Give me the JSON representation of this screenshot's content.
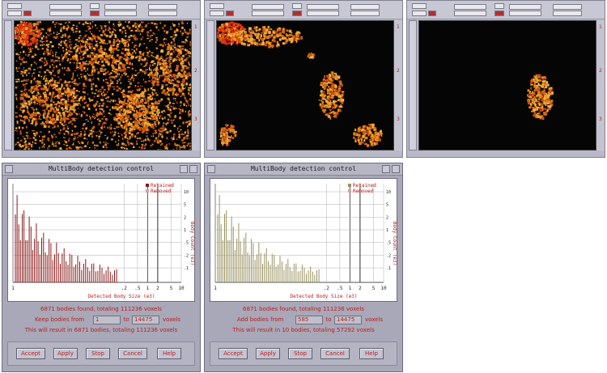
{
  "viewers": [
    {
      "side_labels": [
        "1",
        "2",
        "3"
      ]
    },
    {
      "side_labels": [
        "1",
        "2",
        "3"
      ]
    },
    {
      "side_labels": [
        "1",
        "2",
        "3"
      ]
    }
  ],
  "dialogs": [
    {
      "title": "MultiBody detection control",
      "legend": [
        "Retained",
        "Removed"
      ],
      "xlabel": "Detected Body Size (e3)",
      "ylabel": "Body Count (e3)",
      "x_ticks": [
        "1",
        ".2",
        ".5",
        "1",
        "2",
        "5",
        "10"
      ],
      "y_ticks": [
        "10",
        "5",
        "2",
        "1",
        ".5",
        ".2",
        ".1"
      ],
      "summary": "6871 bodies found, totaling 111236 voxels",
      "range_label": "Keep bodies from",
      "from_value": "1",
      "to_label": "to",
      "to_value": "14475",
      "unit_label": "voxels",
      "result": "This will result in 6871 bodies, totaling 111236 voxels",
      "retained_color": "#8b1a1a",
      "buttons": [
        "Accept",
        "Apply",
        "Stop",
        "Cancel",
        "Help"
      ]
    },
    {
      "title": "MultiBody detection control",
      "legend": [
        "Retained",
        "Removed"
      ],
      "xlabel": "Detected Body Size (e3)",
      "ylabel": "Body Count (e3)",
      "x_ticks": [
        "1",
        ".2",
        ".5",
        "1",
        "2",
        "5",
        "10"
      ],
      "y_ticks": [
        "10",
        "5",
        "2",
        "1",
        ".5",
        ".2",
        ".1"
      ],
      "summary": "6871 bodies found, totaling 111236 voxels",
      "range_label": "Add bodies from",
      "from_value": "585",
      "to_label": "to",
      "to_value": "14475",
      "unit_label": "voxels",
      "result": "This will result in 10 bodies, totaling 57292 voxels",
      "retained_color": "#9a9260",
      "buttons": [
        "Accept",
        "Apply",
        "Stop",
        "Cancel",
        "Help"
      ]
    }
  ],
  "chart_data": [
    {
      "type": "bar",
      "title": "",
      "xlabel": "Detected Body Size (e3)",
      "ylabel": "Body Count (e3)",
      "x_scale": "log",
      "series": [
        {
          "name": "Retained"
        },
        {
          "name": "Removed"
        }
      ],
      "threshold_low": 1,
      "threshold_high": 14475
    },
    {
      "type": "bar",
      "title": "",
      "xlabel": "Detected Body Size (e3)",
      "ylabel": "Body Count (e3)",
      "x_scale": "log",
      "series": [
        {
          "name": "Retained"
        },
        {
          "name": "Removed"
        }
      ],
      "threshold_low": 585,
      "threshold_high": 14475
    }
  ]
}
